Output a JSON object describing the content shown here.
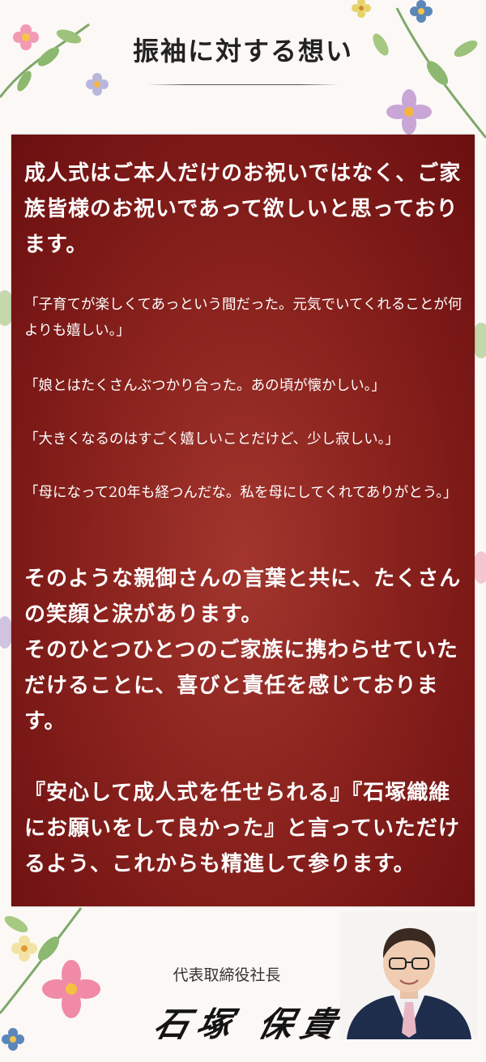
{
  "header": {
    "title": "振袖に対する想い"
  },
  "message": {
    "intro": "成人式はご本人だけのお祝いではなく、ご家族皆様のお祝いであって欲しいと思っております。",
    "quotes": [
      "「子育てが楽しくてあっという間だった。元気でいてくれることが何よりも嬉しい。」",
      "「娘とはたくさんぶつかり合った。あの頃が懐かしい。」",
      "「大きくなるのはすごく嬉しいことだけど、少し寂しい。」",
      "「母になって20年も経つんだな。私を母にしてくれてありがとう。」"
    ],
    "body1": "そのような親御さんの言葉と共に、たくさんの笑顔と涙があります。",
    "body2": "そのひとつひとつのご家族に携わらせていただけることに、喜びと責任を感じております。",
    "closing": "『安心して成人式を任せられる』『石塚織維にお願いをして良かった』と言っていただけるよう、これからも精進して参ります。"
  },
  "signature": {
    "role": "代表取締役社長",
    "name": "石塚 保貴"
  },
  "colors": {
    "panel": "#8a221d",
    "text": "#ffffff",
    "background": "#fbf8f6"
  }
}
